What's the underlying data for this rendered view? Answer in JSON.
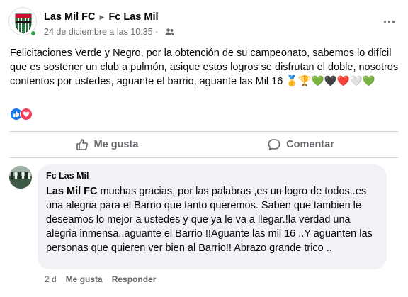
{
  "post": {
    "page_name": "Las Mil FC",
    "target_name": "Fc Las Mil",
    "timestamp": "24 de diciembre a las 10:35",
    "audience_icon": "friends-icon",
    "more_icon": "...",
    "text": "Felicitaciones Verde y Negro, por la obtención de su campeonato, sabemos lo difícil que es sostener un club a pulmón, asique estos logros se disfrutan el doble, nosotros contentos por ustedes, aguante el barrio, aguante las Mil 16 🥇🏆💚🖤❤️🤍💚",
    "reactions": [
      "like",
      "love"
    ]
  },
  "actions": {
    "like_label": "Me gusta",
    "comment_label": "Comentar"
  },
  "comment": {
    "author": "Fc Las Mil",
    "mention": "Las Mil FC",
    "text": " muchas gracias, por las palabras ,es un logro de todos..es una alegria para el Barrio que tanto queremos. Saben que tambien le deseamos lo mejor a ustedes y que ya le va a llegar.!la verdad una alegria inmensa..aguante el Barrio !!Aguante las mil 16 ..Y aguanten las personas que quieren ver bien al Barrio!! Abrazo grande trico ..",
    "age": "2 d",
    "like_label": "Me gusta",
    "reply_label": "Responder"
  },
  "colors": {
    "accent": "#1877f2",
    "love": "#f33e58",
    "secondary_text": "#65676b",
    "bubble": "#f0f2f5"
  }
}
